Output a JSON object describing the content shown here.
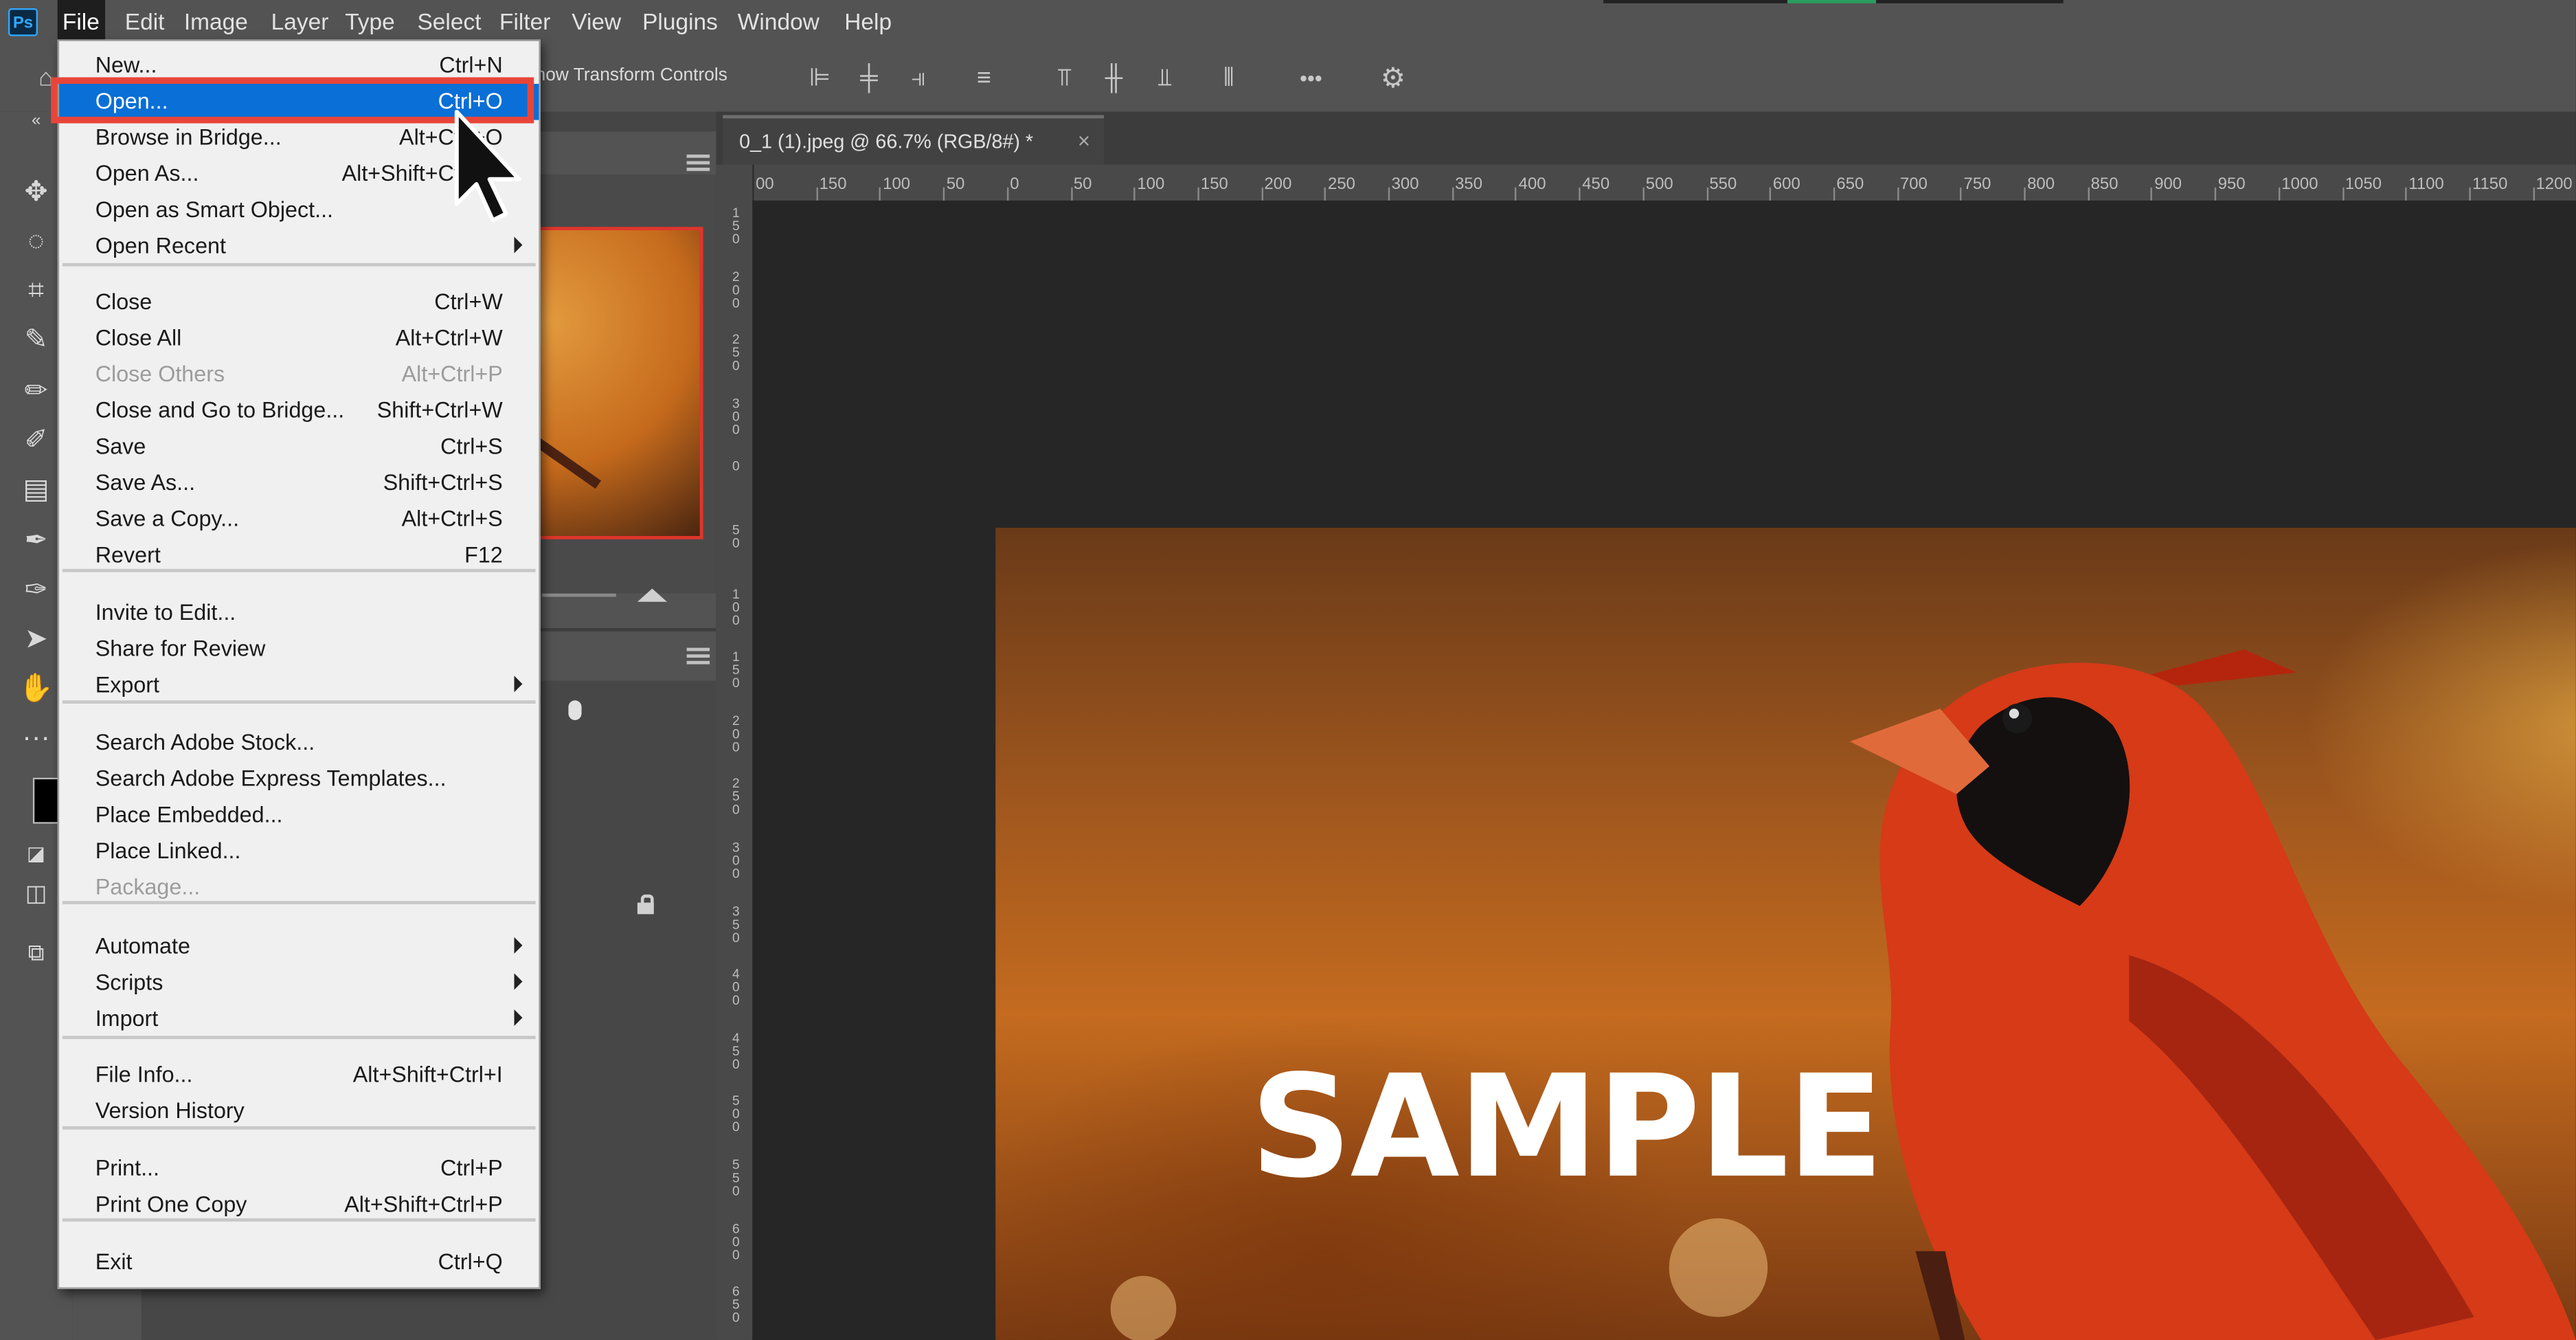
{
  "menubar": {
    "items": [
      "File",
      "Edit",
      "Image",
      "Layer",
      "Type",
      "Select",
      "Filter",
      "View",
      "Plugins",
      "Window",
      "Help"
    ],
    "logo": "Ps"
  },
  "options_bar": {
    "transform_text": "how Transform Controls",
    "more_icon": "•••"
  },
  "document_tab": {
    "title": "0_1 (1).jpeg @ 66.7% (RGB/8#) *",
    "close": "×"
  },
  "ruler": {
    "horizontal": [
      "00",
      "150",
      "100",
      "50",
      "0",
      "50",
      "100",
      "150",
      "200",
      "250",
      "300",
      "350",
      "400",
      "450",
      "500",
      "550",
      "600",
      "650",
      "700",
      "750",
      "800",
      "850",
      "900",
      "950",
      "1000",
      "1050",
      "1100",
      "1150",
      "1200"
    ],
    "vertical": [
      "150",
      "200",
      "250",
      "300",
      "0",
      "50",
      "100",
      "150",
      "200",
      "250",
      "300",
      "350",
      "400",
      "450",
      "500",
      "550",
      "600",
      "650",
      "700"
    ]
  },
  "canvas": {
    "watermark": "SAMPLE"
  },
  "file_menu": {
    "items": [
      {
        "label": "New...",
        "shortcut": "Ctrl+N"
      },
      {
        "label": "Open...",
        "shortcut": "Ctrl+O",
        "highlighted": true
      },
      {
        "label": "Browse in Bridge...",
        "shortcut": "Alt+Ctrl+O"
      },
      {
        "label": "Open As...",
        "shortcut": "Alt+Shift+Ctrl+O"
      },
      {
        "label": "Open as Smart Object...",
        "shortcut": ""
      },
      {
        "label": "Open Recent",
        "submenu": true
      },
      {
        "label": "Close",
        "shortcut": "Ctrl+W"
      },
      {
        "label": "Close All",
        "shortcut": "Alt+Ctrl+W"
      },
      {
        "label": "Close Others",
        "shortcut": "Alt+Ctrl+P",
        "disabled": true
      },
      {
        "label": "Close and Go to Bridge...",
        "shortcut": "Shift+Ctrl+W"
      },
      {
        "label": "Save",
        "shortcut": "Ctrl+S"
      },
      {
        "label": "Save As...",
        "shortcut": "Shift+Ctrl+S"
      },
      {
        "label": "Save a Copy...",
        "shortcut": "Alt+Ctrl+S"
      },
      {
        "label": "Revert",
        "shortcut": "F12"
      },
      {
        "label": "Invite to Edit...",
        "shortcut": ""
      },
      {
        "label": "Share for Review",
        "shortcut": ""
      },
      {
        "label": "Export",
        "submenu": true
      },
      {
        "label": "Search Adobe Stock...",
        "shortcut": ""
      },
      {
        "label": "Search Adobe Express Templates...",
        "shortcut": ""
      },
      {
        "label": "Place Embedded...",
        "shortcut": ""
      },
      {
        "label": "Place Linked...",
        "shortcut": ""
      },
      {
        "label": "Package...",
        "shortcut": "",
        "disabled": true
      },
      {
        "label": "Automate",
        "submenu": true
      },
      {
        "label": "Scripts",
        "submenu": true
      },
      {
        "label": "Import",
        "submenu": true
      },
      {
        "label": "File Info...",
        "shortcut": "Alt+Shift+Ctrl+I"
      },
      {
        "label": "Version History",
        "shortcut": ""
      },
      {
        "label": "Print...",
        "shortcut": "Ctrl+P"
      },
      {
        "label": "Print One Copy",
        "shortcut": "Alt+Shift+Ctrl+P"
      },
      {
        "label": "Exit",
        "shortcut": "Ctrl+Q"
      }
    ]
  },
  "colors": {
    "highlight": "#0a6fd6",
    "annotation_box": "#e8453a"
  },
  "icons": {
    "cursor": "mouse-pointer-icon",
    "tools": [
      "move-icon",
      "lasso-icon",
      "crop-icon",
      "eyedropper-icon",
      "brush-icon",
      "healing-brush-icon",
      "gradient-icon",
      "clone-stamp-icon",
      "pen-icon",
      "path-select-icon",
      "hand-icon",
      "more-tools-icon"
    ]
  }
}
